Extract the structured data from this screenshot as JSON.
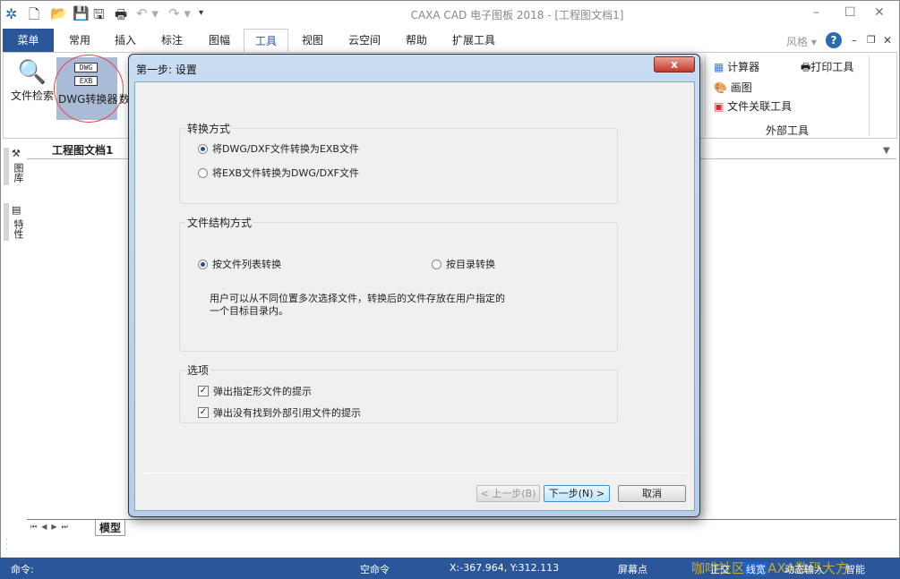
{
  "app": {
    "title": "CAXA CAD 电子图板 2018 - [工程图文档1]"
  },
  "ribbon": {
    "tabs": [
      "菜单",
      "常用",
      "插入",
      "标注",
      "图幅",
      "工具",
      "视图",
      "云空间",
      "帮助",
      "扩展工具"
    ],
    "active_tab": "工具",
    "style_label": "风格",
    "tools": {
      "file_search": "文件检索",
      "dwg_converter": "DWG转换器",
      "data_partial": "数",
      "dwg_tag": "DWG",
      "exb_tag": "EXB",
      "calculator": "计算器",
      "paint": "画图",
      "file_assoc": "文件关联工具",
      "print_tool": "打印工具",
      "group_label": "外部工具"
    }
  },
  "document": {
    "tab": "工程图文档1",
    "layout_tab": "模型"
  },
  "side_panels": [
    "图库",
    "特性"
  ],
  "dialog": {
    "title": "第一步: 设置",
    "close": "x",
    "conversion": {
      "label": "转换方式",
      "options": [
        "将DWG/DXF文件转换为EXB文件",
        "将EXB文件转换为DWG/DXF文件"
      ],
      "selected": 0
    },
    "structure": {
      "label": "文件结构方式",
      "options": [
        "按文件列表转换",
        "按目录转换"
      ],
      "selected": 0,
      "description": "用户可以从不同位置多次选择文件，转换后的文件存放在用户指定的一个目标目录内。"
    },
    "options": {
      "label": "选项",
      "items": [
        {
          "label": "弹出指定形文件的提示",
          "checked": true
        },
        {
          "label": "弹出没有找到外部引用文件的提示",
          "checked": true
        }
      ]
    },
    "buttons": {
      "prev": "< 上一步(B)",
      "next": "下一步(N) >",
      "cancel": "取消"
    }
  },
  "status": {
    "command": "命令:",
    "idle": "空命令",
    "coords": "X:-367.964, Y:312.113",
    "snap": "屏幕点",
    "ortho": "正交",
    "linewidth": "线宽",
    "dynamic": "动态输入",
    "smart": "智能",
    "watermark": "咖啡社区 | CAXA数码大方"
  }
}
